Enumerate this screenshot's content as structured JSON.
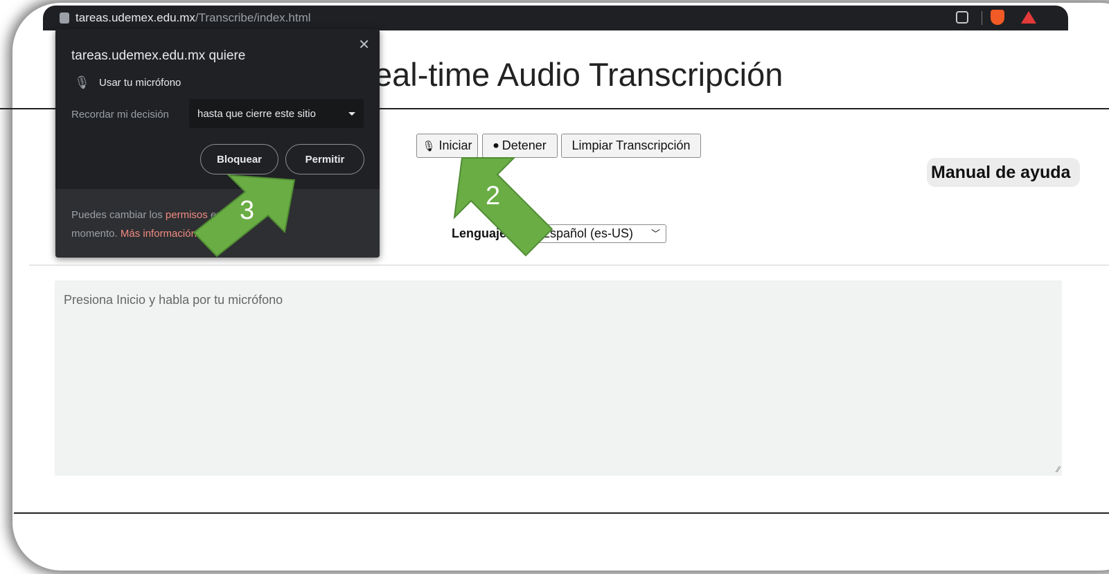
{
  "browser": {
    "url_domain": "tareas.udemex.edu.mx",
    "url_path": "/Transcribe/index.html"
  },
  "page": {
    "title": "eal-time Audio Transcripción",
    "buttons": {
      "iniciar": "Iniciar",
      "detener": "Detener",
      "limpiar": "Limpiar Transcripción"
    },
    "help_link": "Manual de ayuda",
    "language_label": "Lenguaje:",
    "language_value": "Español (es-US)",
    "transcript_placeholder": "Presiona Inicio y habla por tu micrófono"
  },
  "permission_popup": {
    "site_text": "tareas.udemex.edu.mx quiere",
    "permission": "Usar tu micrófono",
    "remember_label": "Recordar mi decisión",
    "remember_value": "hasta que cierre este sitio",
    "block_label": "Bloquear",
    "allow_label": "Permitir",
    "footer_prefix": "Puedes cambiar los",
    "footer_link1": "permisos",
    "footer_middle": "en cualquier",
    "footer_line2": "momento.",
    "footer_link2": "Más información"
  },
  "annotations": {
    "step2": "2",
    "step3": "3",
    "arrow_color": "#6aad45"
  }
}
